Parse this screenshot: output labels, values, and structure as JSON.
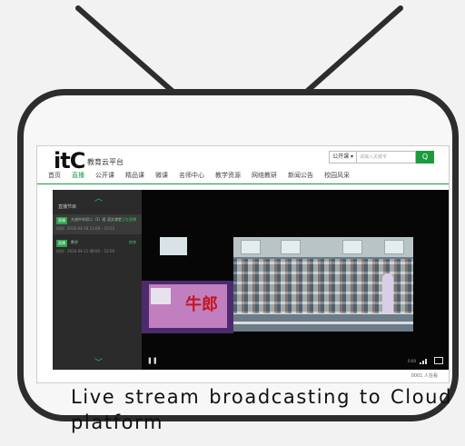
{
  "header": {
    "logo": "itC",
    "site_name": "教育云平台",
    "search_select": "公开课 ▾",
    "search_placeholder": "请输入关键字",
    "search_button": "Q"
  },
  "nav": [
    "首页",
    "直播",
    "公开课",
    "精品课",
    "微课",
    "名师中心",
    "教学资源",
    "网络教研",
    "新闻公告",
    "校园风采"
  ],
  "sidebar": {
    "title": "直播节目",
    "items": [
      {
        "badge": "直播",
        "title": "大成中学初二（1）班 语文课堂",
        "status": "正在直播",
        "time": "时间：2016-04-18 13:09 – 13:52"
      },
      {
        "badge": "直播",
        "title": "数学",
        "status": "结束",
        "time": "时间：2016-04-11 08:00 – 12:00"
      }
    ]
  },
  "player": {
    "slide_text": "牛郎",
    "time": "0:00",
    "viewers": "0001 人在看"
  },
  "caption": "Live stream broadcasting to Cloud platform",
  "colors": {
    "accent": "#1a9c3c",
    "frame": "#2d2d2d"
  }
}
